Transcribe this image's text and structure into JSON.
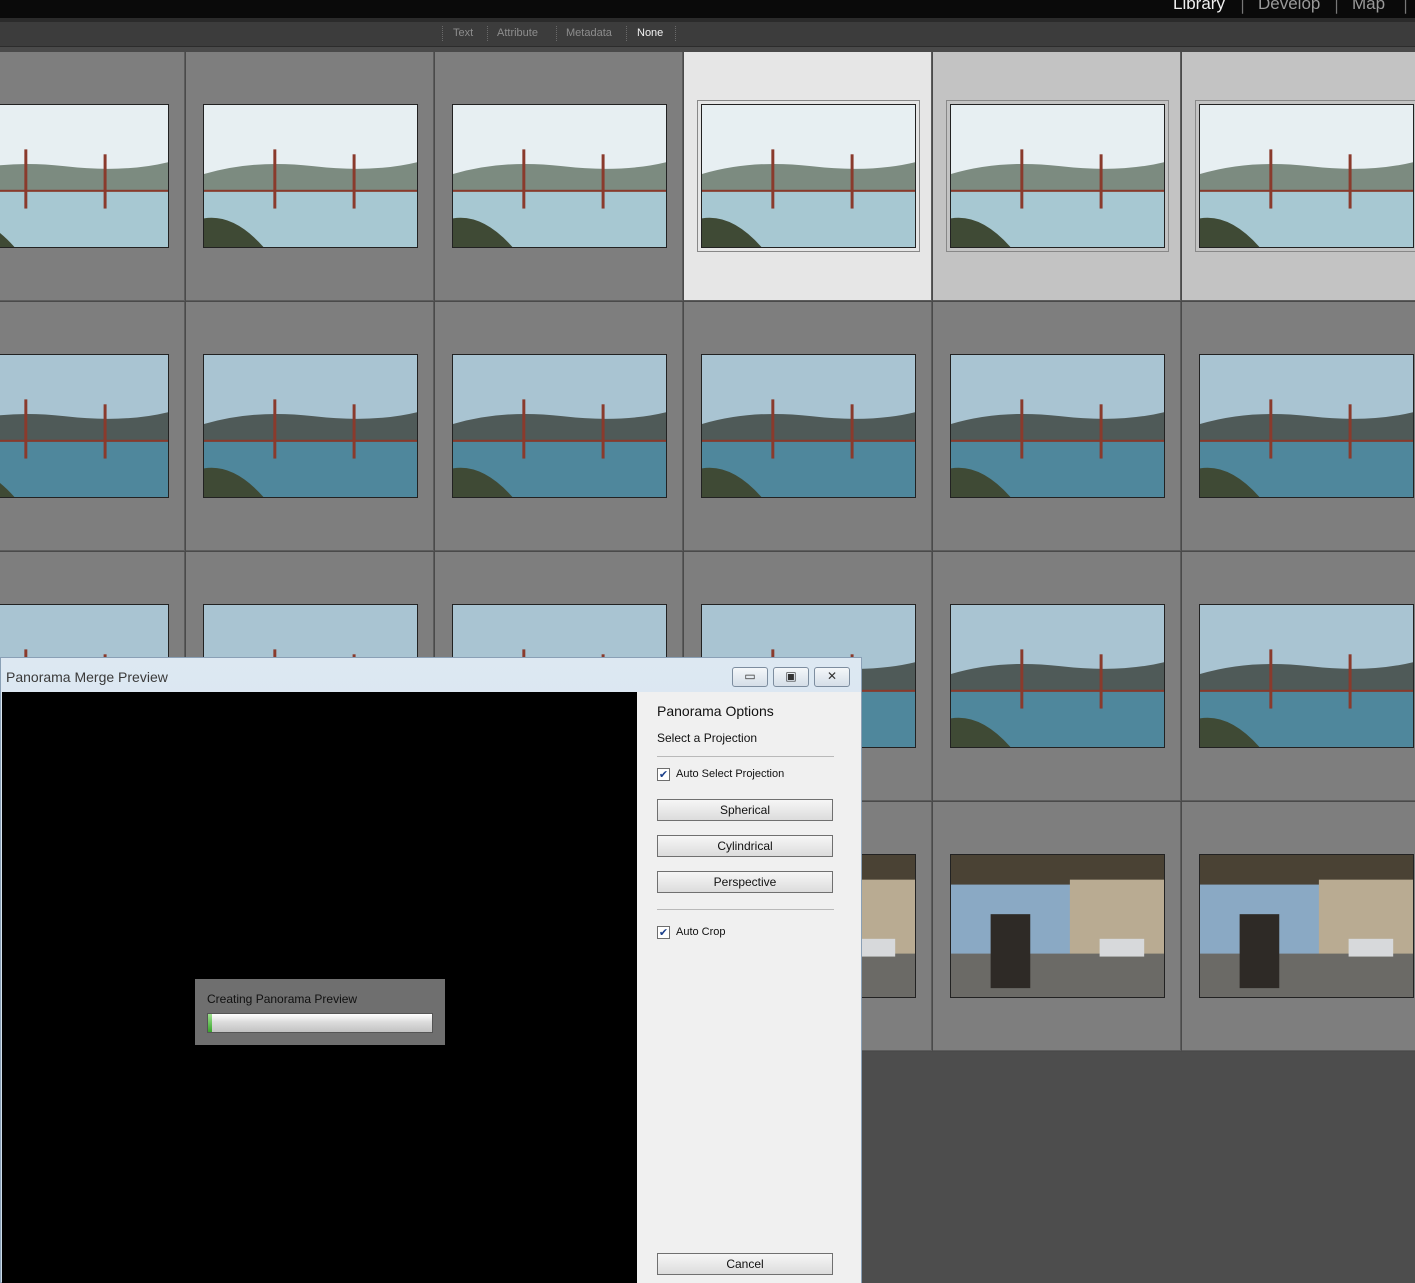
{
  "top_bar": {
    "modules": [
      {
        "label": "Library",
        "active": true
      },
      {
        "label": "Develop",
        "active": false
      },
      {
        "label": "Map",
        "active": false
      }
    ]
  },
  "filter_bar": {
    "items": [
      {
        "label": "Text",
        "active": false
      },
      {
        "label": "Attribute",
        "active": false
      },
      {
        "label": "Metadata",
        "active": false
      },
      {
        "label": "None",
        "active": true
      }
    ]
  },
  "dialog": {
    "title": "Panorama Merge Preview",
    "window_buttons": {
      "minimize": "▭",
      "maximize": "▣",
      "close": "✕"
    },
    "progress": {
      "label": "Creating Panorama Preview",
      "value": 0.02
    },
    "options": {
      "heading": "Panorama Options",
      "subheading": "Select a Projection",
      "auto_select": {
        "label": "Auto Select Projection",
        "checked": true
      },
      "projections": [
        "Spherical",
        "Cylindrical",
        "Perspective"
      ],
      "auto_crop": {
        "label": "Auto Crop",
        "checked": true
      },
      "cancel_label": "Cancel"
    }
  },
  "colors": {
    "grid_cell": "#7e7e7e",
    "selected_cell": "#e6e6e6",
    "secondary_selected_cell": "#c3c3c3",
    "preview_bg": "#000000",
    "dialog_panel": "#f0f0f0"
  }
}
